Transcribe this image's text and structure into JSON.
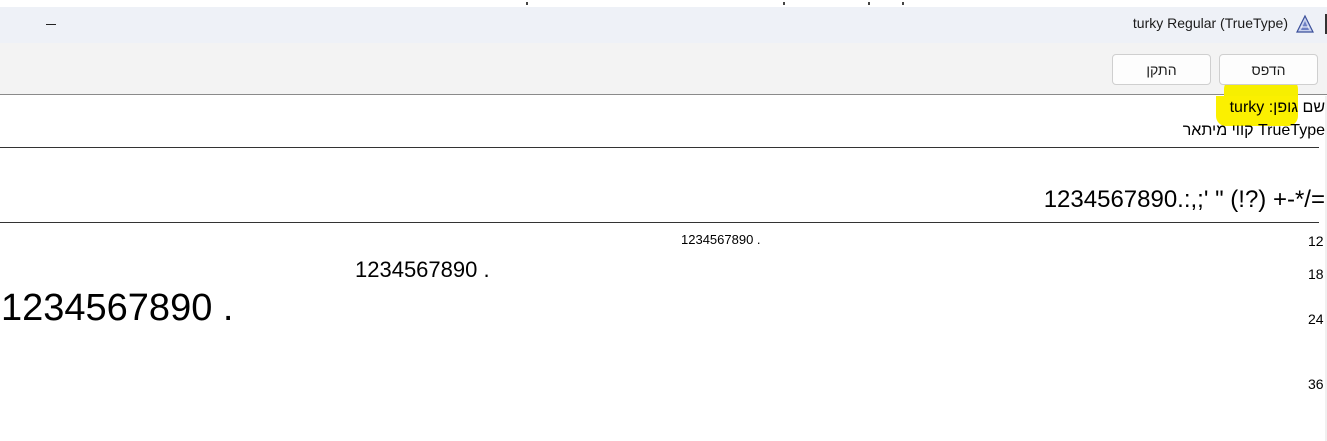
{
  "window": {
    "title": "turky Regular (TrueType)",
    "icons": {
      "app": "font-viewer-icon",
      "minimize": "minimize-icon"
    }
  },
  "toolbar": {
    "print_label": "הדפס",
    "install_label": "התקן"
  },
  "info": {
    "font_name_label": "שם גופן:",
    "font_name_value": "turky",
    "font_type": "TrueType קווי מיתאר"
  },
  "charset_line": "1234567890.:,;' \" (!?) +-*/=",
  "samples": [
    {
      "size_label": "12",
      "text": "1234567890 ."
    },
    {
      "size_label": "18",
      "text": "1234567890 ."
    },
    {
      "size_label": "24",
      "text": "1234567890 ."
    },
    {
      "size_label": "36",
      "text": ""
    }
  ],
  "colors": {
    "highlight": "#fbf000",
    "titlebar_bg": "#eef1f7",
    "toolbar_bg": "#f3f3f3"
  }
}
